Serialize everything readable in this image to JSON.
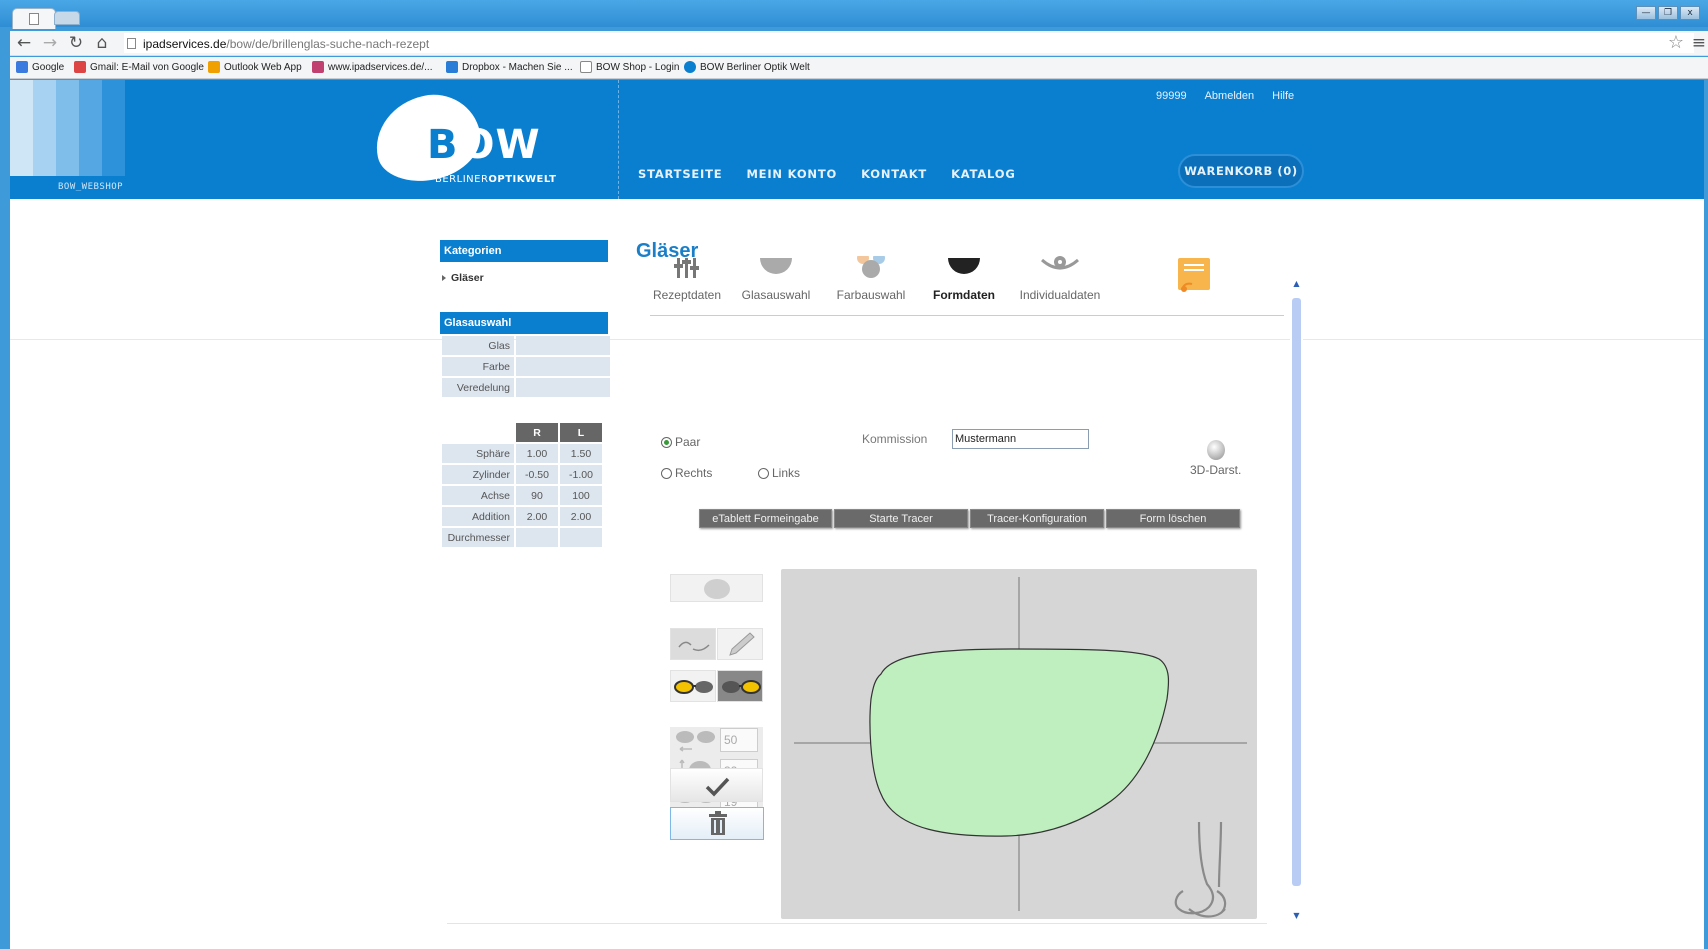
{
  "browser": {
    "url_host": "ipadservices.de",
    "url_path": "/bow/de/brillenglas-suche-nach-rezept",
    "window_controls": [
      "—",
      "❐",
      "x"
    ],
    "bookmarks": [
      {
        "label": "Google",
        "color": "#3b7be0"
      },
      {
        "label": "Gmail: E-Mail von Google",
        "color": "#d44"
      },
      {
        "label": "Outlook Web App",
        "color": "#f0a000"
      },
      {
        "label": "www.ipadservices.de/...",
        "color": "#c04070"
      },
      {
        "label": "Dropbox - Machen Sie ...",
        "color": "#2a7dd6"
      },
      {
        "label": "BOW Shop - Login",
        "color": "#ffffff"
      },
      {
        "label": "BOW Berliner Optik Welt",
        "color": "#0a7fd0"
      }
    ]
  },
  "header": {
    "webshop_label": "BOW_WEBSHOP",
    "logo_word": "OW",
    "logo_letter": "B",
    "logo_sub_a": "BERLINER",
    "logo_sub_b": "OPTIKWELT",
    "nav": [
      "STARTSEITE",
      "MEIN KONTO",
      "KONTAKT",
      "KATALOG"
    ],
    "user_links": [
      "99999",
      "Abmelden",
      "Hilfe"
    ],
    "cart": "WARENKORB (0)",
    "stripe_colors": [
      "#cfe6f7",
      "#a8d2f1",
      "#7fbdeb",
      "#55a7e3",
      "#2e92da"
    ]
  },
  "sidebar": {
    "categories_title": "Kategorien",
    "category_item": "Gläser",
    "glass_title": "Glasauswahl",
    "glass_rows": [
      "Glas",
      "Farbe",
      "Veredelung"
    ],
    "rx_head": [
      "R",
      "L"
    ],
    "rx_rows": [
      {
        "label": "Sphäre",
        "r": "1.00",
        "l": "1.50"
      },
      {
        "label": "Zylinder",
        "r": "-0.50",
        "l": "-1.00"
      },
      {
        "label": "Achse",
        "r": "90",
        "l": "100"
      },
      {
        "label": "Addition",
        "r": "2.00",
        "l": "2.00"
      },
      {
        "label": "Durchmesser",
        "r": "",
        "l": ""
      }
    ]
  },
  "main": {
    "title": "Gläser",
    "steps": [
      "Rezeptdaten",
      "Glasauswahl",
      "Farbauswahl",
      "Formdaten",
      "Individualdaten"
    ],
    "active_step": "Formdaten",
    "radio_paar": "Paar",
    "radio_rechts": "Rechts",
    "radio_links": "Links",
    "kommission_label": "Kommission",
    "kommission_value": "Mustermann",
    "d3_label": "3D-Darst.",
    "buttons": [
      "eTablett Formeingabe",
      "Starte Tracer",
      "Tracer-Konfiguration",
      "Form löschen"
    ],
    "measurements": [
      "50",
      "32",
      "19"
    ],
    "lens_fill": "#bfeebf",
    "accent": "#0a7fd0"
  }
}
